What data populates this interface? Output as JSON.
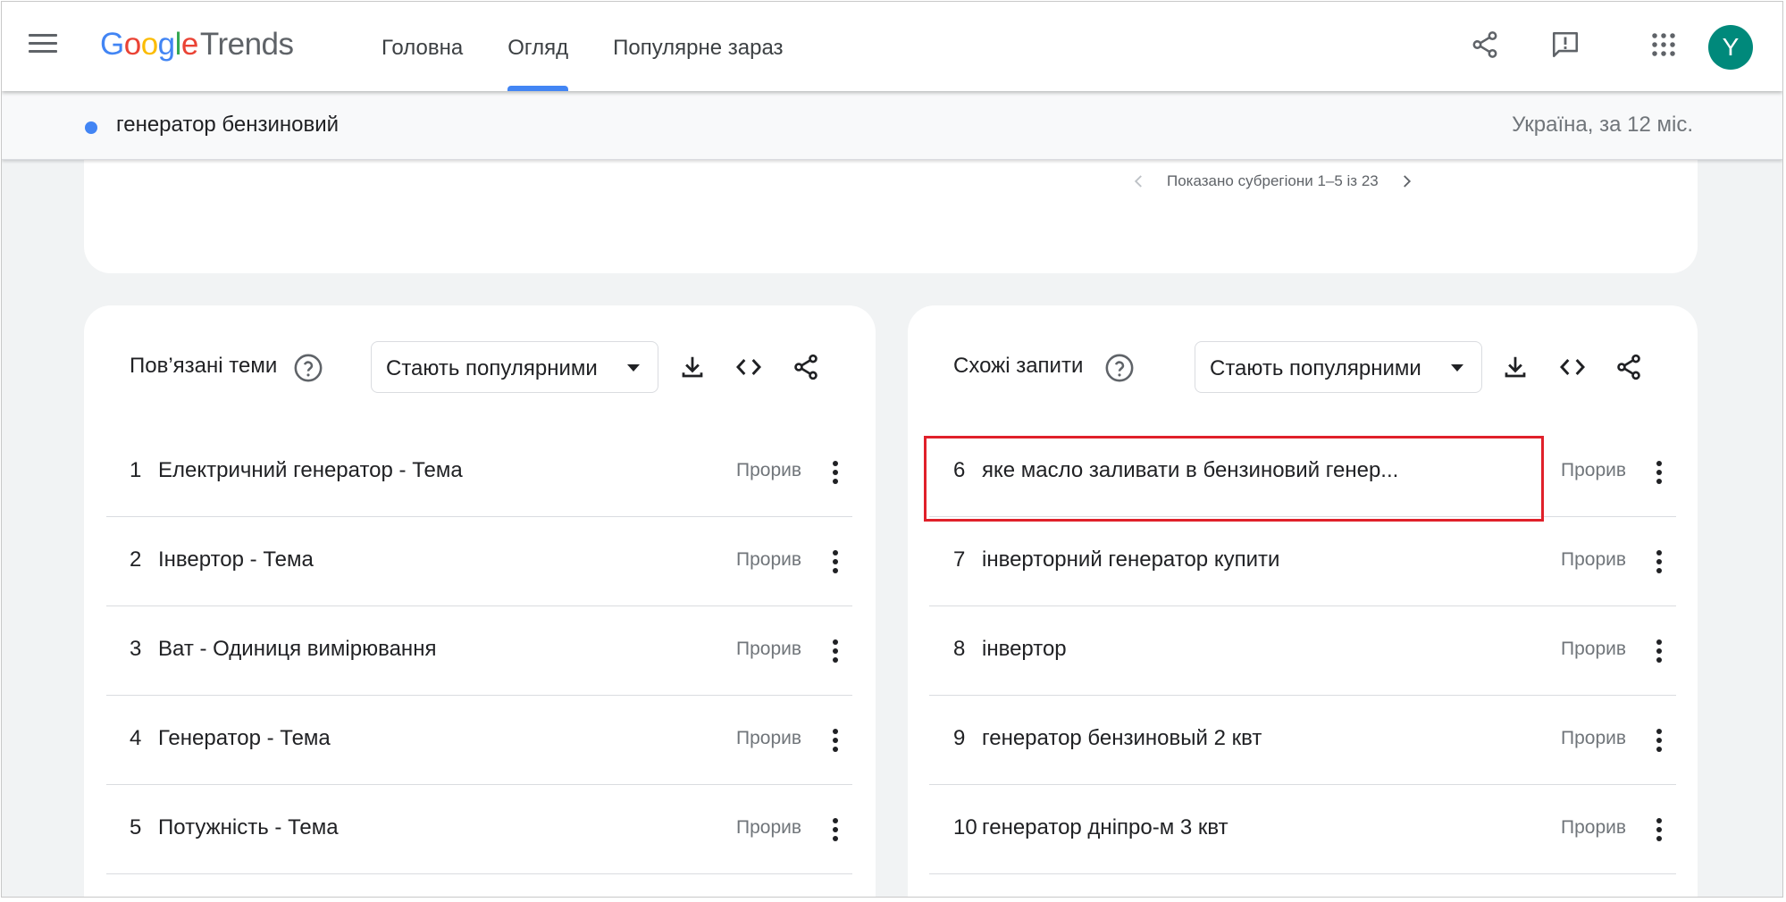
{
  "header": {
    "logo_google": [
      "G",
      "o",
      "o",
      "g",
      "l",
      "e"
    ],
    "logo_product": "Trends",
    "nav": [
      {
        "label": "Головна",
        "active": false
      },
      {
        "label": "Огляд",
        "active": true
      },
      {
        "label": "Популярне зараз",
        "active": false
      }
    ],
    "avatar_letter": "Y",
    "icons": [
      "menu-icon",
      "share-icon",
      "feedback-icon",
      "apps-icon"
    ]
  },
  "search": {
    "term": "генератор бензиновий",
    "term_color": "#4285f4",
    "region": "Україна, за 12 міс."
  },
  "map_card": {
    "pager_text": "Показано субрегіони 1–5 із 23"
  },
  "related_topics": {
    "title": "Пов’язані теми",
    "filter": "Стають популярними",
    "rows": [
      {
        "rank": "1",
        "label": "Електричний генератор - Тема",
        "value": "Прорив"
      },
      {
        "rank": "2",
        "label": "Інвертор - Тема",
        "value": "Прорив"
      },
      {
        "rank": "3",
        "label": "Ват - Одиниця вимірювання",
        "value": "Прорив"
      },
      {
        "rank": "4",
        "label": "Генератор - Тема",
        "value": "Прорив"
      },
      {
        "rank": "5",
        "label": "Потужність - Тема",
        "value": "Прорив"
      }
    ]
  },
  "related_queries": {
    "title": "Схожі запити",
    "filter": "Стають популярними",
    "rows": [
      {
        "rank": "6",
        "label": "яке масло заливати в бензиновий генер...",
        "value": "Прорив"
      },
      {
        "rank": "7",
        "label": "інверторний генератор купити",
        "value": "Прорив"
      },
      {
        "rank": "8",
        "label": "інвертор",
        "value": "Прорив"
      },
      {
        "rank": "9",
        "label": "генератор бензиновый 2 квт",
        "value": "Прорив"
      },
      {
        "rank": "10",
        "label": "генератор дніпро-м 3 квт",
        "value": "Прорив"
      }
    ]
  },
  "colors": {
    "accent": "#4285f4",
    "avatar": "#00897b",
    "highlight": "#e0202a",
    "background": "#f1f3f4"
  }
}
